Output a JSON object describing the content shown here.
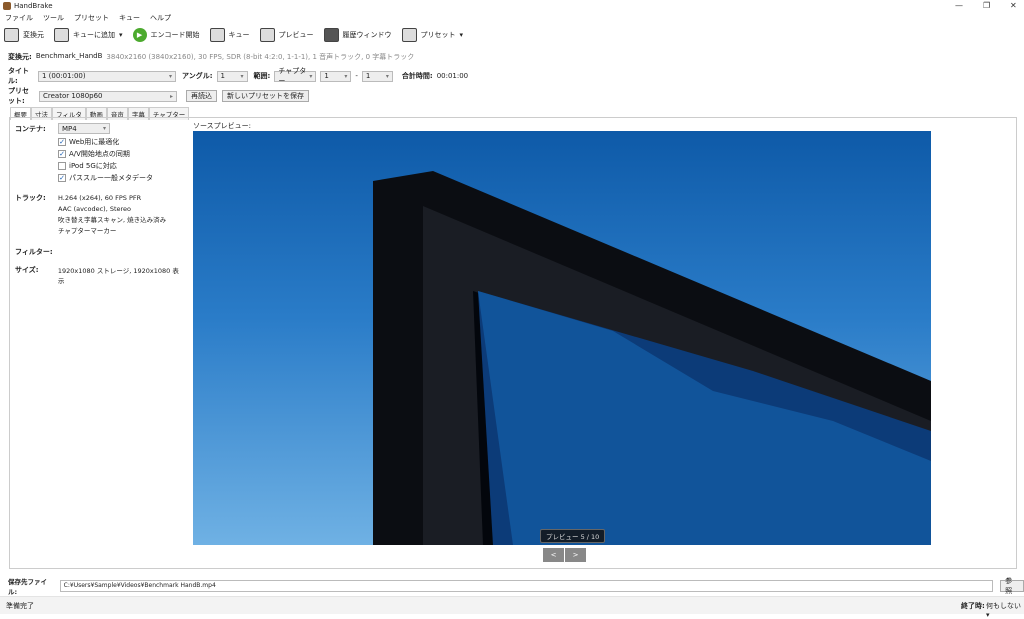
{
  "window": {
    "title": "HandBrake"
  },
  "menu": [
    "ファイル",
    "ツール",
    "プリセット",
    "キュー",
    "ヘルプ"
  ],
  "toolbar": {
    "source": "変換元",
    "add_queue": "キューに追加",
    "start": "エンコード開始",
    "queue": "キュー",
    "preview": "プレビュー",
    "activity": "履歴ウィンドウ",
    "presets": "プリセット"
  },
  "source": {
    "label": "変換元:",
    "name": "Benchmark_HandB",
    "info": "3840x2160 (3840x2160), 30 FPS, SDR (8-bit 4:2:0, 1-1-1), 1 音声トラック, 0 字幕トラック"
  },
  "title_row": {
    "title_label": "タイトル:",
    "title_value": "1  (00:01:00)",
    "angle_label": "アングル:",
    "angle_value": "1",
    "range_label": "範囲:",
    "range_type": "チャプター",
    "range_start": "1",
    "range_sep": "-",
    "range_end": "1",
    "duration_label": "合計時間:",
    "duration_value": "00:01:00"
  },
  "preset_row": {
    "label": "プリセット:",
    "value": "Creator 1080p60",
    "reload": "再読込",
    "save_new": "新しいプリセットを保存"
  },
  "tabs": [
    "概要",
    "寸法",
    "フィルタ",
    "動画",
    "音声",
    "字幕",
    "チャプター"
  ],
  "summary": {
    "container_label": "コンテナ:",
    "container_value": "MP4",
    "options": [
      {
        "label": "Web用に最適化",
        "checked": true
      },
      {
        "label": "A/V開始地点の同期",
        "checked": true
      },
      {
        "label": "iPod 5Gに対応",
        "checked": false
      },
      {
        "label": "パススルー一般メタデータ",
        "checked": true
      }
    ],
    "tracks_label": "トラック:",
    "tracks": [
      "H.264 (x264), 60 FPS PFR",
      "AAC (avcodec), Stereo",
      "吹き替え字幕スキャン, 焼き込み済み",
      "チャプターマーカー"
    ],
    "filters_label": "フィルター:",
    "size_label": "サイズ:",
    "size_value": "1920x1080 ストレージ, 1920x1080 表示"
  },
  "preview": {
    "label": "ソースプレビュー:",
    "counter": "プレビュー 5 / 10",
    "prev": "<",
    "next": ">"
  },
  "destination": {
    "label": "保存先ファイル:",
    "value": "C:¥Users¥Sample¥Videos¥Benchmark HandB.mp4",
    "browse": "参照"
  },
  "status": {
    "text": "準備完了",
    "when_done_label": "終了時:",
    "when_done_value": "何もしない"
  }
}
